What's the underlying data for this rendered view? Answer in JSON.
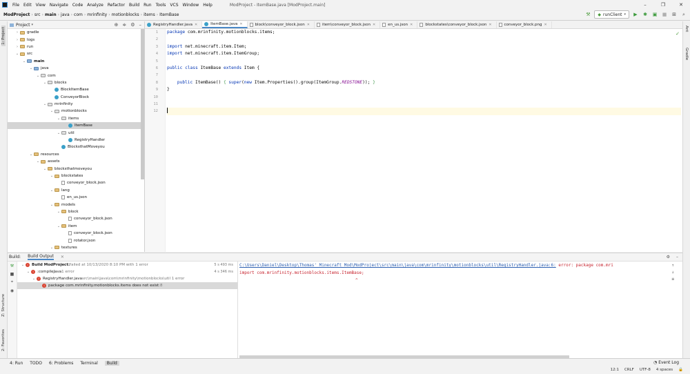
{
  "menu": {
    "items": [
      "File",
      "Edit",
      "View",
      "Navigate",
      "Code",
      "Analyze",
      "Refactor",
      "Build",
      "Run",
      "Tools",
      "VCS",
      "Window",
      "Help"
    ],
    "window_title": "ModProject - ItemBase.java [ModProject.main]",
    "controls": [
      "–",
      "❐",
      "✕"
    ]
  },
  "breadcrumb": [
    "ModProject",
    "src",
    "main",
    "java",
    "com",
    "mrinfinity",
    "motionblocks",
    "items",
    "ItemBase"
  ],
  "toolbar": {
    "run_config": "runClient"
  },
  "left_strip": {
    "project": "1: Project",
    "structure": "Z: Structure",
    "favorites": "2: Favorites"
  },
  "right_strip": {
    "ant": "Ant",
    "gradle": "Gradle"
  },
  "project_panel": {
    "title": "Project",
    "rows": [
      {
        "indent": 1,
        "arrow": "›",
        "icon": "folder",
        "label": "gradle"
      },
      {
        "indent": 1,
        "arrow": "›",
        "icon": "folder",
        "label": "logs"
      },
      {
        "indent": 1,
        "arrow": "›",
        "icon": "folder",
        "label": "run"
      },
      {
        "indent": 1,
        "arrow": "⌄",
        "icon": "folder",
        "label": "src"
      },
      {
        "indent": 2,
        "arrow": "⌄",
        "icon": "src",
        "label": "main",
        "bold": true
      },
      {
        "indent": 3,
        "arrow": "⌄",
        "icon": "src",
        "label": "java"
      },
      {
        "indent": 4,
        "arrow": "⌄",
        "icon": "pkg",
        "label": "com"
      },
      {
        "indent": 5,
        "arrow": "⌄",
        "icon": "pkg",
        "label": "blocks"
      },
      {
        "indent": 6,
        "arrow": "",
        "icon": "class",
        "label": "BlockItemBase"
      },
      {
        "indent": 6,
        "arrow": "",
        "icon": "class",
        "label": "ConveyorBlock"
      },
      {
        "indent": 5,
        "arrow": "⌄",
        "icon": "pkg",
        "label": "mrinfinity"
      },
      {
        "indent": 6,
        "arrow": "⌄",
        "icon": "pkg",
        "label": "motionblocks"
      },
      {
        "indent": 7,
        "arrow": "⌄",
        "icon": "pkg",
        "label": "items"
      },
      {
        "indent": 8,
        "arrow": "",
        "icon": "class",
        "label": "ItemBase",
        "selected": true
      },
      {
        "indent": 7,
        "arrow": "⌄",
        "icon": "pkg",
        "label": "util"
      },
      {
        "indent": 8,
        "arrow": "",
        "icon": "class",
        "label": "RegistryHandler"
      },
      {
        "indent": 7,
        "arrow": "",
        "icon": "class",
        "label": "BlocksthatMoveyou"
      },
      {
        "indent": 3,
        "arrow": "⌄",
        "icon": "folder",
        "label": "resources"
      },
      {
        "indent": 4,
        "arrow": "⌄",
        "icon": "folder",
        "label": "assets"
      },
      {
        "indent": 5,
        "arrow": "⌄",
        "icon": "folder",
        "label": "blocksthatmoveyou"
      },
      {
        "indent": 6,
        "arrow": "⌄",
        "icon": "folder",
        "label": "blockstates"
      },
      {
        "indent": 7,
        "arrow": "",
        "icon": "json",
        "label": "conveyor_block.json"
      },
      {
        "indent": 6,
        "arrow": "⌄",
        "icon": "folder",
        "label": "lang"
      },
      {
        "indent": 7,
        "arrow": "",
        "icon": "json",
        "label": "en_us.json"
      },
      {
        "indent": 6,
        "arrow": "⌄",
        "icon": "folder",
        "label": "models"
      },
      {
        "indent": 7,
        "arrow": "⌄",
        "icon": "folder",
        "label": "block"
      },
      {
        "indent": 8,
        "arrow": "",
        "icon": "json",
        "label": "conveyor_block.json"
      },
      {
        "indent": 7,
        "arrow": "⌄",
        "icon": "folder",
        "label": "item"
      },
      {
        "indent": 8,
        "arrow": "",
        "icon": "json",
        "label": "conveyor_block.json"
      },
      {
        "indent": 8,
        "arrow": "",
        "icon": "json",
        "label": "rotator.json"
      },
      {
        "indent": 6,
        "arrow": "⌄",
        "icon": "folder",
        "label": "textures"
      }
    ]
  },
  "editor": {
    "tabs": [
      {
        "label": "RegistryHandler.java",
        "active": false
      },
      {
        "label": "ItemBase.java",
        "active": true
      },
      {
        "label": "block\\conveyor_block.json",
        "active": false
      },
      {
        "label": "item\\conveyor_block.json",
        "active": false
      },
      {
        "label": "en_us.json",
        "active": false
      },
      {
        "label": "blockstates\\conveyor_block.json",
        "active": false
      },
      {
        "label": "conveyor_block.png",
        "active": false
      }
    ],
    "line_numbers": [
      "1",
      "2",
      "3",
      "4",
      "5",
      "6",
      "7",
      "8",
      "9",
      "10",
      "11",
      "12"
    ],
    "lines": [
      [
        {
          "t": "package ",
          "c": "kw"
        },
        {
          "t": "com.mrinfinity.motionblocks.items;",
          "c": ""
        }
      ],
      [],
      [
        {
          "t": "import ",
          "c": "kw"
        },
        {
          "t": "net.minecraft.item.Item;",
          "c": ""
        }
      ],
      [
        {
          "t": "import ",
          "c": "kw"
        },
        {
          "t": "net.minecraft.item.ItemGroup;",
          "c": ""
        }
      ],
      [],
      [
        {
          "t": "public class ",
          "c": "kw"
        },
        {
          "t": "ItemBase ",
          "c": ""
        },
        {
          "t": "extends ",
          "c": "kw"
        },
        {
          "t": "Item {",
          "c": ""
        }
      ],
      [],
      [
        {
          "t": "    public ",
          "c": "kw"
        },
        {
          "t": "ItemBase() ",
          "c": ""
        },
        {
          "t": "{ ",
          "c": "green"
        },
        {
          "t": "super",
          "c": "kw"
        },
        {
          "t": "(",
          "c": ""
        },
        {
          "t": "new ",
          "c": "kw"
        },
        {
          "t": "Item.Properties().group(ItemGroup.",
          "c": ""
        },
        {
          "t": "REDSTONE",
          "c": "st"
        },
        {
          "t": ")); ",
          "c": ""
        },
        {
          "t": "}",
          "c": "green"
        }
      ],
      [
        {
          "t": "}",
          "c": ""
        }
      ],
      [],
      [],
      []
    ],
    "current_line": 11
  },
  "build_panel": {
    "tabs": [
      "Build:",
      "Build Output"
    ],
    "rows": [
      {
        "indent": 0,
        "label": "Build ModProject:",
        "suffix": " failed at 10/13/2020 8:10 PM with 1 error",
        "time": "5 s 493 ms",
        "err": true,
        "bold": true
      },
      {
        "indent": 1,
        "label": ":compileJava",
        "suffix": "  1 error",
        "time": "4 s 346 ms",
        "err": true
      },
      {
        "indent": 2,
        "label": "RegistryHandler.java",
        "suffix": "  src\\main\\java\\com\\mrinfinity\\motionblocks\\util 1 error",
        "time": "",
        "err": true
      },
      {
        "indent": 3,
        "label": "package com.mrinfinity.motionblocks.items does not exist",
        "suffix": " :8",
        "time": "",
        "err": true,
        "selected": true
      }
    ],
    "output": {
      "link": "C:\\Users\\Daniel\\Desktop\\Thomas' Minecraft Mod\\ModProject\\src\\main\\java\\com\\mrinfinity\\motionblocks\\util\\RegistryHandler.java:6:",
      "error": " error: package com.mri",
      "line2": "import com.mrinfinity.motionblocks.items.ItemBase;",
      "caret": "^"
    }
  },
  "statusbar": {
    "tabs": [
      "4: Run",
      "TODO",
      "6: Problems",
      "Terminal",
      "Build"
    ],
    "event_log": "Event Log",
    "info": [
      "12:1",
      "CRLF",
      "UTF-8",
      "4 spaces"
    ]
  }
}
